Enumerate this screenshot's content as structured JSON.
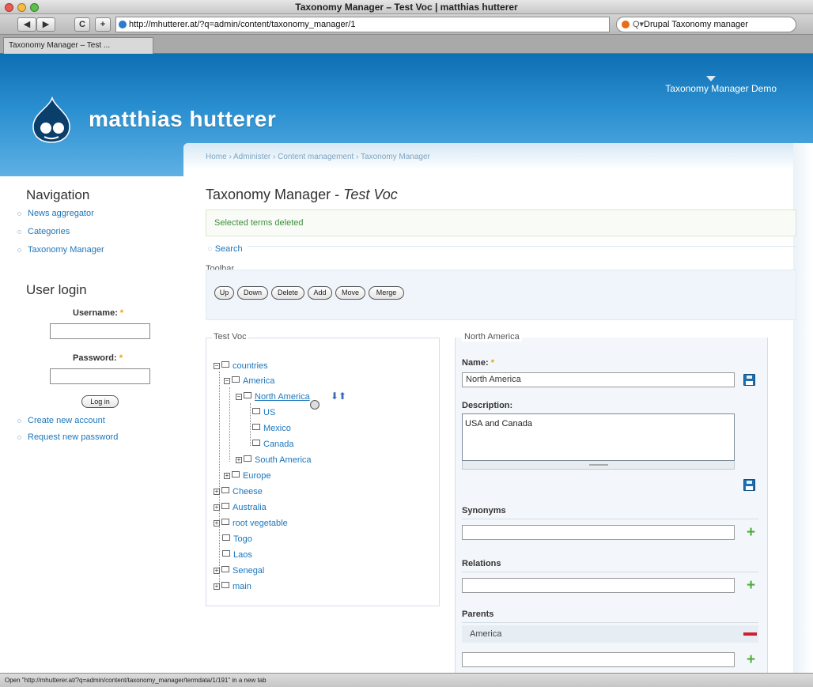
{
  "window": {
    "title": "Taxonomy Manager – Test Voc | matthias hutterer",
    "traffic_colors": [
      "#ec5a53",
      "#f5bd3f",
      "#5ac14a"
    ]
  },
  "toolbar": {
    "back_label": "◀",
    "forward_label": "▶",
    "reload_label": "C",
    "add_label": "+",
    "url": "http://mhutterer.at/?q=admin/content/taxonomy_manager/1",
    "search_text": "Drupal Taxonomy manager",
    "search_glyph": "Q▾",
    "tab_label": "Taxonomy Manager – Test ..."
  },
  "site": {
    "name": "matthias hutterer",
    "primary_link": "Taxonomy Manager Demo",
    "header_colors": [
      "#0e6fb2",
      "#5eb0e4"
    ]
  },
  "breadcrumb": "Home › Administer › Content management › Taxonomy Manager",
  "page": {
    "title_prefix": "Taxonomy Manager - ",
    "title_voc": "Test Voc",
    "message": "Selected terms deleted",
    "search_link": "Search",
    "toolbar_legend": "Toolbar",
    "buttons": [
      "Up",
      "Down",
      "Delete",
      "Add",
      "Move",
      "Merge"
    ]
  },
  "tree": {
    "legend": "Test Voc",
    "items": [
      {
        "label": "countries",
        "exp": "⊟"
      },
      {
        "label": "America",
        "exp": "⊟"
      },
      {
        "label": "North America",
        "exp": "⊟"
      },
      {
        "label": "US",
        "exp": ""
      },
      {
        "label": "Mexico",
        "exp": ""
      },
      {
        "label": "Canada",
        "exp": ""
      },
      {
        "label": "South America",
        "exp": "⊞"
      },
      {
        "label": "Europe",
        "exp": "⊞"
      },
      {
        "label": "Cheese",
        "exp": "⊞"
      },
      {
        "label": "Australia",
        "exp": "⊞"
      },
      {
        "label": "root vegetable",
        "exp": "⊞"
      },
      {
        "label": "Togo",
        "exp": ""
      },
      {
        "label": "Laos",
        "exp": ""
      },
      {
        "label": "Senegal",
        "exp": "⊞"
      },
      {
        "label": "main",
        "exp": "⊞"
      }
    ],
    "move_arrows": "⬇⬆"
  },
  "term_form": {
    "legend": "North America",
    "name_label": "Name:",
    "required_mark": "*",
    "name_value": "North America",
    "description_label": "Description:",
    "description_value": "USA and Canada",
    "synonyms_label": "Synonyms",
    "relations_label": "Relations",
    "parents_label": "Parents",
    "parent_value": "America",
    "plus_glyph": "+"
  },
  "sidebar": {
    "navigation_title": "Navigation",
    "nav_items": [
      "News aggregator",
      "Categories",
      "Taxonomy Manager"
    ],
    "login_title": "User login",
    "username_label": "Username:",
    "password_label": "Password:",
    "login_button": "Log in",
    "links": [
      "Create new account",
      "Request new password"
    ]
  },
  "status_bar": "Open \"http://mhutterer.at/?q=admin/content/taxonomy_manager/termdata/1/191\" in a new tab"
}
